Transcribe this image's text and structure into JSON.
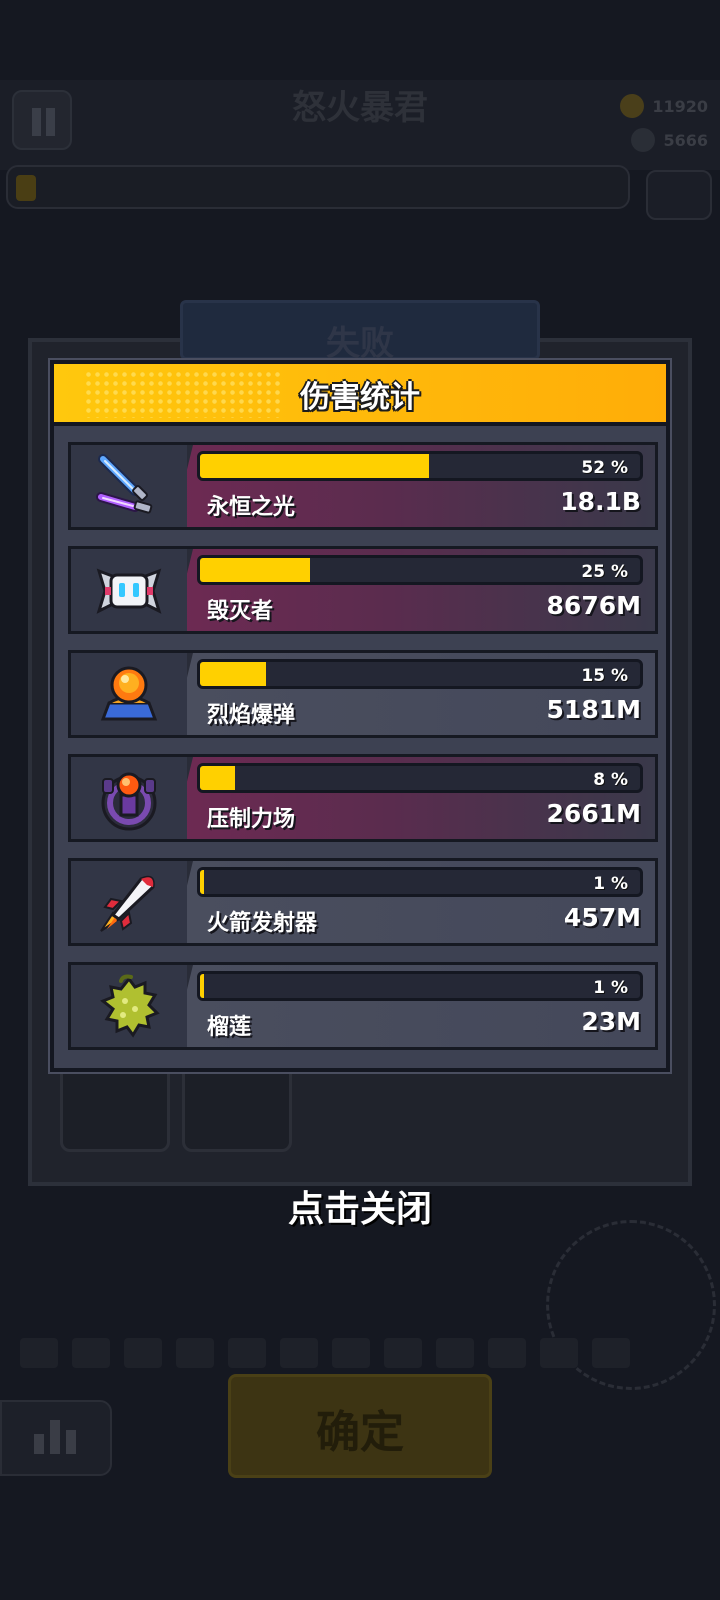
{
  "background": {
    "level_title": "怒火暴君",
    "coins": "11920",
    "gems": "5666",
    "result_banner": "失败",
    "confirm_label": "确定"
  },
  "popup": {
    "title": "伤害统计",
    "rows": [
      {
        "icon": "dual-lightsaber-icon",
        "name": "永恒之光",
        "percent_label": "52 %",
        "percent": 52,
        "value": "18.1B",
        "highlight": true
      },
      {
        "icon": "robot-drone-icon",
        "name": "毁灭者",
        "percent_label": "25 %",
        "percent": 25,
        "value": "8676M",
        "highlight": true
      },
      {
        "icon": "fire-bomb-icon",
        "name": "烈焰爆弹",
        "percent_label": "15 %",
        "percent": 15,
        "value": "5181M",
        "highlight": false
      },
      {
        "icon": "force-field-icon",
        "name": "压制力场",
        "percent_label": "8 %",
        "percent": 8,
        "value": "2661M",
        "highlight": true
      },
      {
        "icon": "rocket-icon",
        "name": "火箭发射器",
        "percent_label": "1 %",
        "percent": 1,
        "value": "457M",
        "highlight": false
      },
      {
        "icon": "durian-icon",
        "name": "榴莲",
        "percent_label": "1 %",
        "percent": 1,
        "value": "23M",
        "highlight": false
      }
    ]
  },
  "close_hint": "点击关闭",
  "colors": {
    "header_yellow": "#ffc80d",
    "bar_fill": "#ffd000",
    "panel_bg": "#3d4152"
  }
}
